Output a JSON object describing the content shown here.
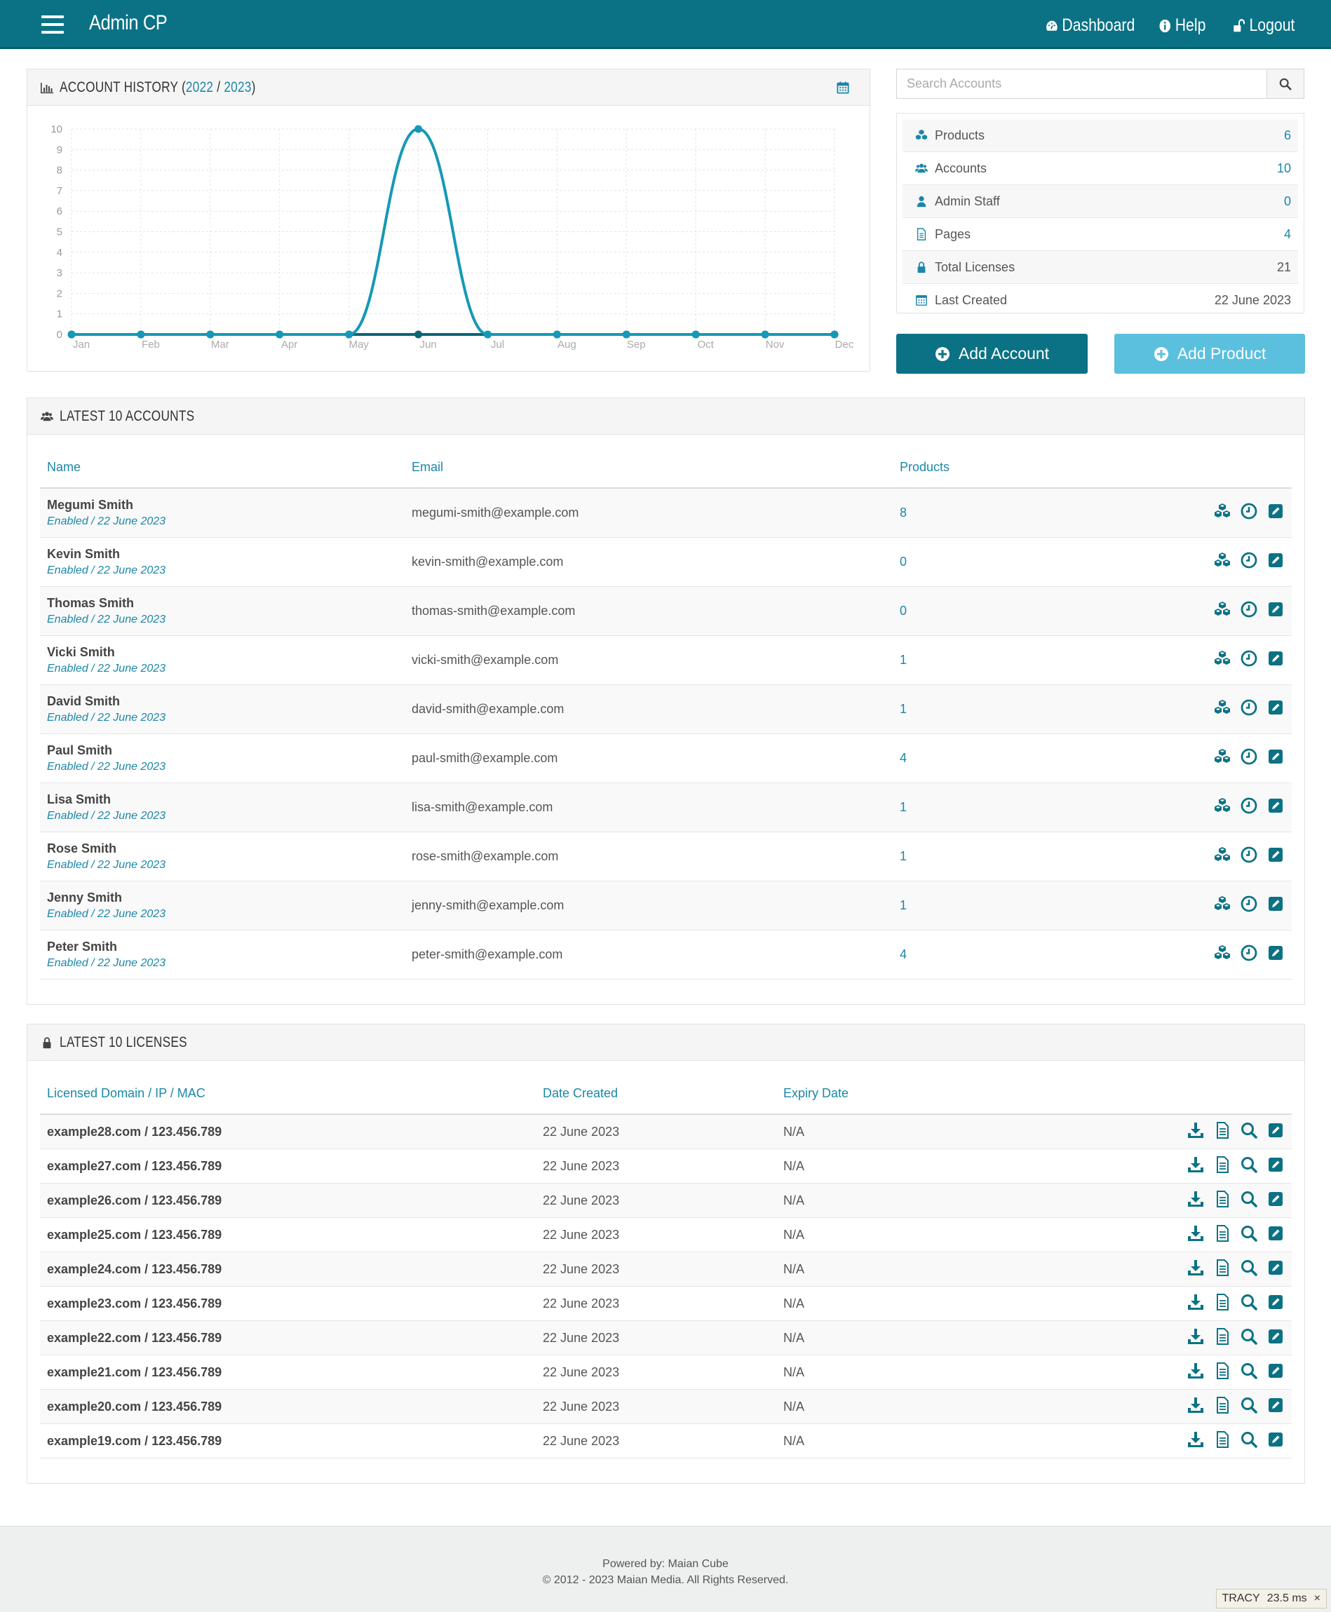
{
  "header": {
    "title": "Admin CP",
    "nav": [
      {
        "label": "Dashboard",
        "icon": "dashboard-icon"
      },
      {
        "label": "Help",
        "icon": "info-icon"
      },
      {
        "label": "Logout",
        "icon": "unlock-icon"
      }
    ]
  },
  "history": {
    "title_prefix": "ACCOUNT HISTORY (",
    "year1": "2022",
    "sep": " / ",
    "year2": "2023",
    "title_suffix": ")"
  },
  "chart_data": {
    "type": "line",
    "categories": [
      "Jan",
      "Feb",
      "Mar",
      "Apr",
      "May",
      "Jun",
      "Jul",
      "Aug",
      "Sep",
      "Oct",
      "Nov",
      "Dec"
    ],
    "series": [
      {
        "values": [
          0,
          0,
          0,
          0,
          0,
          10,
          0,
          0,
          0,
          0,
          0,
          0
        ],
        "color": "#1599b5"
      },
      {
        "values": [
          0,
          0,
          0,
          0,
          0,
          0,
          0,
          0,
          0,
          0,
          0,
          0
        ],
        "color": "#0b6478"
      }
    ],
    "ylim": [
      0,
      10
    ],
    "yticks": [
      0,
      1,
      2,
      3,
      4,
      5,
      6,
      7,
      8,
      9,
      10
    ],
    "grid": true
  },
  "search": {
    "placeholder": "Search Accounts"
  },
  "stats": [
    {
      "label": "Products",
      "value": "6",
      "icon": "cubes-icon",
      "link": true
    },
    {
      "label": "Accounts",
      "value": "10",
      "icon": "users-icon",
      "link": true
    },
    {
      "label": "Admin Staff",
      "value": "0",
      "icon": "user-icon",
      "link": true
    },
    {
      "label": "Pages",
      "value": "4",
      "icon": "file-icon",
      "link": true
    },
    {
      "label": "Total Licenses",
      "value": "21",
      "icon": "lock-icon",
      "link": false
    },
    {
      "label": "Last Created",
      "value": "22 June 2023",
      "icon": "calendar-icon",
      "link": false
    }
  ],
  "buttons": {
    "add_account": "Add Account",
    "add_product": "Add Product"
  },
  "accounts": {
    "title": "LATEST 10 ACCOUNTS",
    "columns": [
      "Name",
      "Email",
      "Products"
    ],
    "rows": [
      {
        "name": "Megumi Smith",
        "status": "Enabled / 22 June 2023",
        "email": "megumi-smith@example.com",
        "products": "8"
      },
      {
        "name": "Kevin Smith",
        "status": "Enabled / 22 June 2023",
        "email": "kevin-smith@example.com",
        "products": "0"
      },
      {
        "name": "Thomas Smith",
        "status": "Enabled / 22 June 2023",
        "email": "thomas-smith@example.com",
        "products": "0"
      },
      {
        "name": "Vicki Smith",
        "status": "Enabled / 22 June 2023",
        "email": "vicki-smith@example.com",
        "products": "1"
      },
      {
        "name": "David Smith",
        "status": "Enabled / 22 June 2023",
        "email": "david-smith@example.com",
        "products": "1"
      },
      {
        "name": "Paul Smith",
        "status": "Enabled / 22 June 2023",
        "email": "paul-smith@example.com",
        "products": "4"
      },
      {
        "name": "Lisa Smith",
        "status": "Enabled / 22 June 2023",
        "email": "lisa-smith@example.com",
        "products": "1"
      },
      {
        "name": "Rose Smith",
        "status": "Enabled / 22 June 2023",
        "email": "rose-smith@example.com",
        "products": "1"
      },
      {
        "name": "Jenny Smith",
        "status": "Enabled / 22 June 2023",
        "email": "jenny-smith@example.com",
        "products": "1"
      },
      {
        "name": "Peter Smith",
        "status": "Enabled / 22 June 2023",
        "email": "peter-smith@example.com",
        "products": "4"
      }
    ]
  },
  "licenses": {
    "title": "LATEST 10 LICENSES",
    "columns": [
      "Licensed Domain / IP / MAC",
      "Date Created",
      "Expiry Date"
    ],
    "rows": [
      {
        "domain": "example28.com / 123.456.789",
        "created": "22 June 2023",
        "expiry": "N/A"
      },
      {
        "domain": "example27.com / 123.456.789",
        "created": "22 June 2023",
        "expiry": "N/A"
      },
      {
        "domain": "example26.com / 123.456.789",
        "created": "22 June 2023",
        "expiry": "N/A"
      },
      {
        "domain": "example25.com / 123.456.789",
        "created": "22 June 2023",
        "expiry": "N/A"
      },
      {
        "domain": "example24.com / 123.456.789",
        "created": "22 June 2023",
        "expiry": "N/A"
      },
      {
        "domain": "example23.com / 123.456.789",
        "created": "22 June 2023",
        "expiry": "N/A"
      },
      {
        "domain": "example22.com / 123.456.789",
        "created": "22 June 2023",
        "expiry": "N/A"
      },
      {
        "domain": "example21.com / 123.456.789",
        "created": "22 June 2023",
        "expiry": "N/A"
      },
      {
        "domain": "example20.com / 123.456.789",
        "created": "22 June 2023",
        "expiry": "N/A"
      },
      {
        "domain": "example19.com / 123.456.789",
        "created": "22 June 2023",
        "expiry": "N/A"
      }
    ]
  },
  "footer": {
    "powered": "Powered by: Maian Cube",
    "copyright": "© 2012 - 2023 Maian Media. All Rights Reserved."
  },
  "tracy": {
    "label": "TRACY",
    "time": "23.5 ms",
    "close": "×"
  },
  "colors": {
    "accent": "#0b7285",
    "link": "#1b87a8",
    "light_button": "#5bc0de"
  }
}
